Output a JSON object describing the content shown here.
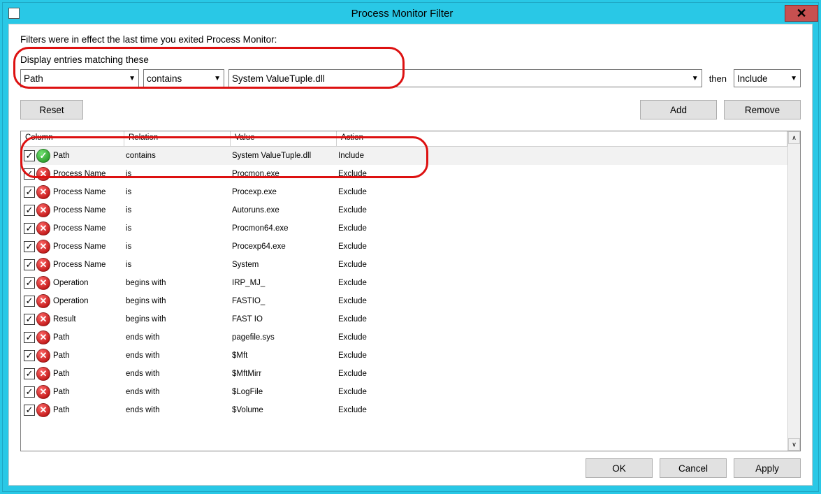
{
  "window": {
    "title": "Process Monitor Filter"
  },
  "info_line": "Filters were in effect the last time you exited Process Monitor:",
  "heading": "Display entries matching these",
  "filter": {
    "column": "Path",
    "relation": "contains",
    "value": "System ValueTuple.dll",
    "then_label": "then",
    "action": "Include"
  },
  "buttons": {
    "reset": "Reset",
    "add": "Add",
    "remove": "Remove",
    "ok": "OK",
    "cancel": "Cancel",
    "apply": "Apply"
  },
  "columns": {
    "col": "Column",
    "rel": "Relation",
    "val": "Value",
    "act": "Action"
  },
  "rows": [
    {
      "checked": true,
      "type": "include",
      "column": "Path",
      "relation": "contains",
      "value": "System ValueTuple.dll",
      "action": "Include",
      "selected": true
    },
    {
      "checked": true,
      "type": "exclude",
      "column": "Process Name",
      "relation": "is",
      "value": "Procmon.exe",
      "action": "Exclude"
    },
    {
      "checked": true,
      "type": "exclude",
      "column": "Process Name",
      "relation": "is",
      "value": "Procexp.exe",
      "action": "Exclude"
    },
    {
      "checked": true,
      "type": "exclude",
      "column": "Process Name",
      "relation": "is",
      "value": "Autoruns.exe",
      "action": "Exclude"
    },
    {
      "checked": true,
      "type": "exclude",
      "column": "Process Name",
      "relation": "is",
      "value": "Procmon64.exe",
      "action": "Exclude"
    },
    {
      "checked": true,
      "type": "exclude",
      "column": "Process Name",
      "relation": "is",
      "value": "Procexp64.exe",
      "action": "Exclude"
    },
    {
      "checked": true,
      "type": "exclude",
      "column": "Process Name",
      "relation": "is",
      "value": "System",
      "action": "Exclude"
    },
    {
      "checked": true,
      "type": "exclude",
      "column": "Operation",
      "relation": "begins with",
      "value": "IRP_MJ_",
      "action": "Exclude"
    },
    {
      "checked": true,
      "type": "exclude",
      "column": "Operation",
      "relation": "begins with",
      "value": "FASTIO_",
      "action": "Exclude"
    },
    {
      "checked": true,
      "type": "exclude",
      "column": "Result",
      "relation": "begins with",
      "value": "FAST IO",
      "action": "Exclude"
    },
    {
      "checked": true,
      "type": "exclude",
      "column": "Path",
      "relation": "ends with",
      "value": "pagefile.sys",
      "action": "Exclude"
    },
    {
      "checked": true,
      "type": "exclude",
      "column": "Path",
      "relation": "ends with",
      "value": "$Mft",
      "action": "Exclude"
    },
    {
      "checked": true,
      "type": "exclude",
      "column": "Path",
      "relation": "ends with",
      "value": "$MftMirr",
      "action": "Exclude"
    },
    {
      "checked": true,
      "type": "exclude",
      "column": "Path",
      "relation": "ends with",
      "value": "$LogFile",
      "action": "Exclude"
    },
    {
      "checked": true,
      "type": "exclude",
      "column": "Path",
      "relation": "ends with",
      "value": "$Volume",
      "action": "Exclude"
    }
  ]
}
